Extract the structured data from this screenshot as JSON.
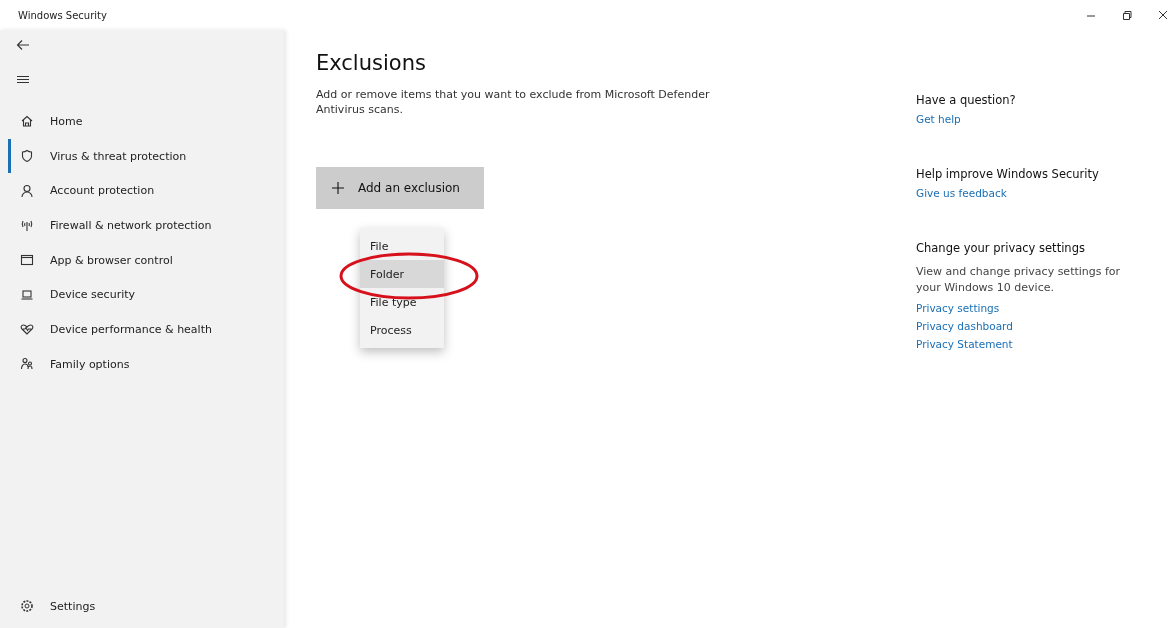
{
  "window": {
    "title": "Windows Security"
  },
  "sidebar": {
    "items": [
      {
        "kind": "home",
        "label": "Home",
        "selected": false
      },
      {
        "kind": "shield",
        "label": "Virus & threat protection",
        "selected": true
      },
      {
        "kind": "person",
        "label": "Account protection",
        "selected": false
      },
      {
        "kind": "antenna",
        "label": "Firewall & network protection",
        "selected": false
      },
      {
        "kind": "window",
        "label": "App & browser control",
        "selected": false
      },
      {
        "kind": "laptop",
        "label": "Device security",
        "selected": false
      },
      {
        "kind": "heart",
        "label": "Device performance & health",
        "selected": false
      },
      {
        "kind": "family",
        "label": "Family options",
        "selected": false
      }
    ],
    "settings": "Settings"
  },
  "main": {
    "title": "Exclusions",
    "description": "Add or remove items that you want to exclude from Microsoft Defender Antivirus scans.",
    "add_button": "Add an exclusion",
    "menu": [
      {
        "label": "File",
        "selected": false
      },
      {
        "label": "Folder",
        "selected": true
      },
      {
        "label": "File type",
        "selected": false
      },
      {
        "label": "Process",
        "selected": false
      }
    ]
  },
  "aside": [
    {
      "heading": "Have a question?",
      "links": [
        "Get help"
      ]
    },
    {
      "heading": "Help improve Windows Security",
      "links": [
        "Give us feedback"
      ]
    },
    {
      "heading": "Change your privacy settings",
      "text": "View and change privacy settings for your Windows 10 device.",
      "links": [
        "Privacy settings",
        "Privacy dashboard",
        "Privacy Statement"
      ]
    }
  ]
}
